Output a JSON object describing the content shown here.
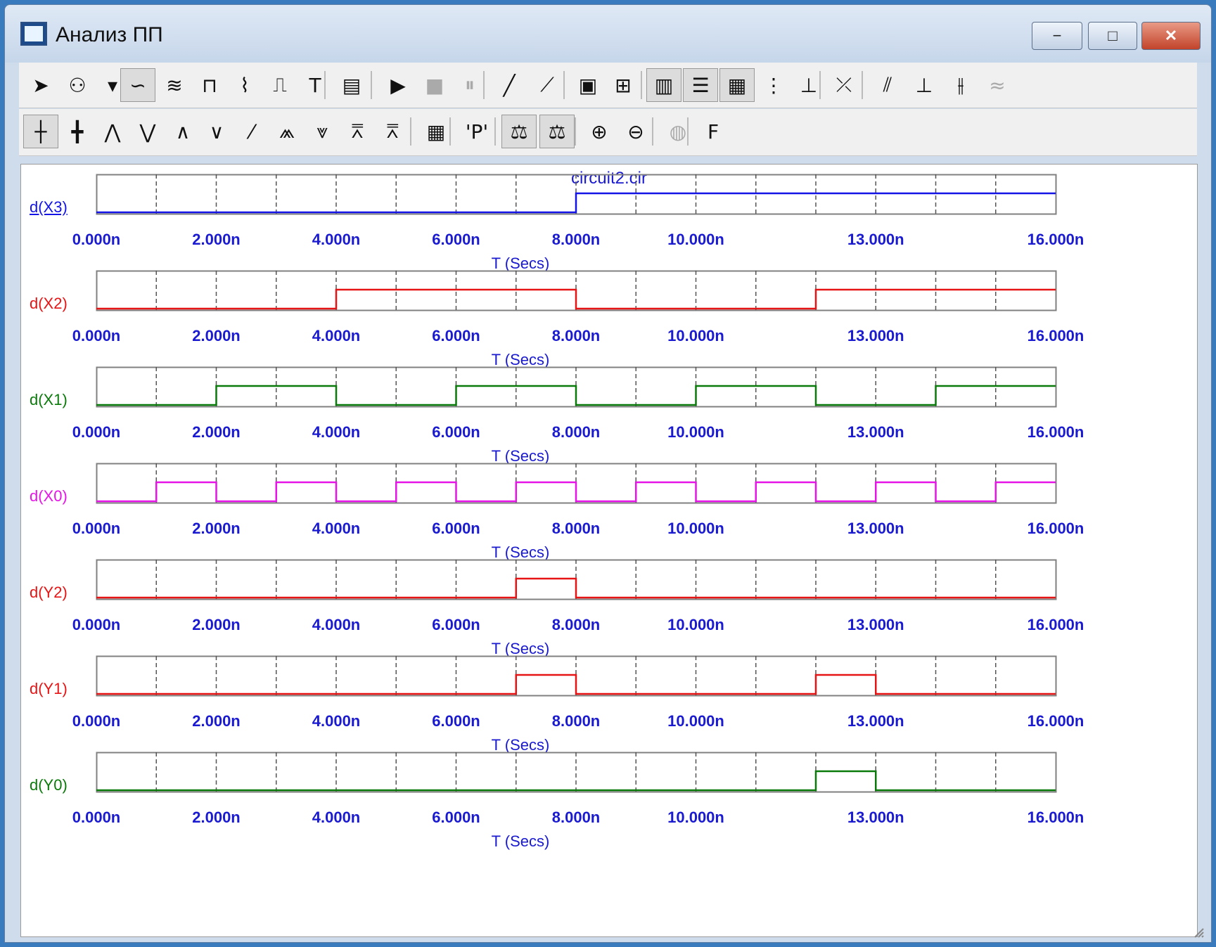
{
  "window": {
    "title": "Анализ ПП",
    "minimize_label": "−",
    "maximize_label": "□",
    "close_label": "✕"
  },
  "toolbar1": [
    {
      "name": "select-arrow-icon",
      "glyph": "➤"
    },
    {
      "name": "add-trace-icon",
      "glyph": "⚇"
    },
    {
      "name": "dropdown-arrow-icon",
      "glyph": "▾"
    },
    {
      "name": "curve-icon",
      "glyph": "∽",
      "pressed": true
    },
    {
      "name": "waveform-icon",
      "glyph": "≋"
    },
    {
      "name": "bus-icon",
      "glyph": "⊓"
    },
    {
      "name": "probe-icon",
      "glyph": "⌇"
    },
    {
      "name": "step-icon",
      "glyph": "⎍"
    },
    {
      "name": "text-icon",
      "glyph": "T"
    },
    {
      "name": "properties-icon",
      "glyph": "▤"
    },
    {
      "name": "run-icon",
      "glyph": "▶"
    },
    {
      "name": "stop-icon",
      "glyph": "■",
      "disabled": true
    },
    {
      "name": "pause-icon",
      "glyph": "⏸",
      "disabled": true
    },
    {
      "name": "line-icon",
      "glyph": "╱"
    },
    {
      "name": "polyline-icon",
      "glyph": "⟋"
    },
    {
      "name": "frame-icon",
      "glyph": "▣"
    },
    {
      "name": "grid-dots-icon",
      "glyph": "⊞"
    },
    {
      "name": "vertical-grid-icon",
      "glyph": "▥",
      "pressed": true
    },
    {
      "name": "horizontal-grid-icon",
      "glyph": "☰",
      "pressed": true
    },
    {
      "name": "minor-grid-icon",
      "glyph": "▦",
      "pressed": true
    },
    {
      "name": "dotted-grid-icon",
      "glyph": "⋮"
    },
    {
      "name": "baseline-icon",
      "glyph": "⊥"
    },
    {
      "name": "tangent-icon",
      "glyph": "⤫"
    },
    {
      "name": "cursor-left-icon",
      "glyph": "⫽"
    },
    {
      "name": "cursor-right-icon",
      "glyph": "⊥"
    },
    {
      "name": "cursor-both-icon",
      "glyph": "⫲"
    },
    {
      "name": "cursor-tag-icon",
      "glyph": "≈",
      "disabled": true
    }
  ],
  "toolbar2": [
    {
      "name": "cursor-crosshair-icon",
      "glyph": "┼",
      "pressed": true
    },
    {
      "name": "cursor-point-icon",
      "glyph": "╋"
    },
    {
      "name": "peak-icon",
      "glyph": "⋀"
    },
    {
      "name": "valley-icon",
      "glyph": "⋁"
    },
    {
      "name": "high-icon",
      "glyph": "∧"
    },
    {
      "name": "low-icon",
      "glyph": "∨"
    },
    {
      "name": "slope-icon",
      "glyph": "⁄"
    },
    {
      "name": "local-max-icon",
      "glyph": "⩕"
    },
    {
      "name": "local-min-icon",
      "glyph": "⩔"
    },
    {
      "name": "global-high-icon",
      "glyph": "⩞"
    },
    {
      "name": "global-low-icon",
      "glyph": "⩞"
    },
    {
      "name": "table-icon",
      "glyph": "▦"
    },
    {
      "name": "point-mark-icon",
      "glyph": "'P'"
    },
    {
      "name": "x-scale-icon",
      "glyph": "⚖",
      "pressed": true
    },
    {
      "name": "y-scale-icon",
      "glyph": "⚖",
      "pressed": true
    },
    {
      "name": "zoom-in-icon",
      "glyph": "⊕"
    },
    {
      "name": "zoom-out-icon",
      "glyph": "⊖"
    },
    {
      "name": "globe-icon",
      "glyph": "◍",
      "disabled": true
    },
    {
      "name": "font-icon",
      "glyph": "F"
    }
  ],
  "colors": {
    "axis_text": "#1a1ad0",
    "grid": "#555555",
    "frame": "#808080"
  },
  "plot": {
    "file_title": "circuit2.cir",
    "x_axis_label": "T (Secs)",
    "x_range": [
      0,
      16
    ],
    "grid_step": 1,
    "panels": [
      {
        "label": "d(X3)",
        "color": "#1414e6",
        "link": true,
        "high_intervals": [
          [
            8,
            16
          ]
        ],
        "ticks": [
          "0.000n",
          "2.000n",
          "4.000n",
          "6.000n",
          "8.000n",
          "10.000n",
          "13.000n",
          "16.000n"
        ]
      },
      {
        "label": "d(X2)",
        "color": "#e61414",
        "high_intervals": [
          [
            4,
            8
          ],
          [
            12,
            16
          ]
        ],
        "ticks": [
          "0.000n",
          "2.000n",
          "4.000n",
          "6.000n",
          "8.000n",
          "10.000n",
          "13.000n",
          "16.000n"
        ]
      },
      {
        "label": "d(X1)",
        "color": "#0a7a0a",
        "high_intervals": [
          [
            2,
            4
          ],
          [
            6,
            8
          ],
          [
            10,
            12
          ],
          [
            14,
            16
          ]
        ],
        "ticks": [
          "0.000n",
          "2.000n",
          "4.000n",
          "6.000n",
          "8.000n",
          "10.000n",
          "13.000n",
          "16.000n"
        ]
      },
      {
        "label": "d(X0)",
        "color": "#e614e6",
        "high_intervals": [
          [
            1,
            2
          ],
          [
            3,
            4
          ],
          [
            5,
            6
          ],
          [
            7,
            8
          ],
          [
            9,
            10
          ],
          [
            11,
            12
          ],
          [
            13,
            14
          ],
          [
            15,
            16
          ]
        ],
        "ticks": [
          "0.000n",
          "2.000n",
          "4.000n",
          "6.000n",
          "8.000n",
          "10.000n",
          "13.000n",
          "16.000n"
        ]
      },
      {
        "label": "d(Y2)",
        "color": "#e61414",
        "high_intervals": [
          [
            7,
            8
          ]
        ],
        "ticks": [
          "0.000n",
          "2.000n",
          "4.000n",
          "6.000n",
          "8.000n",
          "10.000n",
          "13.000n",
          "16.000n"
        ]
      },
      {
        "label": "d(Y1)",
        "color": "#e61414",
        "high_intervals": [
          [
            7,
            8
          ],
          [
            12,
            13
          ]
        ],
        "ticks": [
          "0.000n",
          "2.000n",
          "4.000n",
          "6.000n",
          "8.000n",
          "10.000n",
          "13.000n",
          "16.000n"
        ]
      },
      {
        "label": "d(Y0)",
        "color": "#0a7a0a",
        "high_intervals": [
          [
            12,
            13
          ]
        ],
        "ticks": [
          "0.000n",
          "2.000n",
          "4.000n",
          "6.000n",
          "8.000n",
          "10.000n",
          "13.000n",
          "16.000n"
        ]
      }
    ]
  },
  "chart_data": [
    {
      "type": "line",
      "series": [
        {
          "name": "d(X3)",
          "x": [
            0,
            8,
            8,
            16
          ],
          "values": [
            0,
            0,
            1,
            1
          ]
        }
      ],
      "xlabel": "T (Secs)",
      "xlim": [
        0,
        16
      ]
    },
    {
      "type": "line",
      "series": [
        {
          "name": "d(X2)",
          "x": [
            0,
            4,
            4,
            8,
            8,
            12,
            12,
            16
          ],
          "values": [
            0,
            0,
            1,
            1,
            0,
            0,
            1,
            1
          ]
        }
      ],
      "xlabel": "T (Secs)",
      "xlim": [
        0,
        16
      ]
    },
    {
      "type": "line",
      "series": [
        {
          "name": "d(X1)",
          "x": [
            0,
            2,
            2,
            4,
            4,
            6,
            6,
            8,
            8,
            10,
            10,
            12,
            12,
            14,
            14,
            16
          ],
          "values": [
            0,
            0,
            1,
            1,
            0,
            0,
            1,
            1,
            0,
            0,
            1,
            1,
            0,
            0,
            1,
            1
          ]
        }
      ],
      "xlabel": "T (Secs)",
      "xlim": [
        0,
        16
      ]
    },
    {
      "type": "line",
      "series": [
        {
          "name": "d(X0)",
          "x": [
            0,
            1,
            1,
            2,
            2,
            3,
            3,
            4,
            4,
            5,
            5,
            6,
            6,
            7,
            7,
            8,
            8,
            9,
            9,
            10,
            10,
            11,
            11,
            12,
            12,
            13,
            13,
            14,
            14,
            15,
            15,
            16
          ],
          "values": [
            0,
            0,
            1,
            1,
            0,
            0,
            1,
            1,
            0,
            0,
            1,
            1,
            0,
            0,
            1,
            1,
            0,
            0,
            1,
            1,
            0,
            0,
            1,
            1,
            0,
            0,
            1,
            1,
            0,
            0,
            1,
            1
          ]
        }
      ],
      "xlabel": "T (Secs)",
      "xlim": [
        0,
        16
      ]
    },
    {
      "type": "line",
      "series": [
        {
          "name": "d(Y2)",
          "x": [
            0,
            7,
            7,
            8,
            8,
            16
          ],
          "values": [
            0,
            0,
            1,
            1,
            0,
            0
          ]
        }
      ],
      "xlabel": "T (Secs)",
      "xlim": [
        0,
        16
      ]
    },
    {
      "type": "line",
      "series": [
        {
          "name": "d(Y1)",
          "x": [
            0,
            7,
            7,
            8,
            8,
            12,
            12,
            13,
            13,
            16
          ],
          "values": [
            0,
            0,
            1,
            1,
            0,
            0,
            1,
            1,
            0,
            0
          ]
        }
      ],
      "xlabel": "T (Secs)",
      "xlim": [
        0,
        16
      ]
    },
    {
      "type": "line",
      "series": [
        {
          "name": "d(Y0)",
          "x": [
            0,
            12,
            12,
            13,
            13,
            16
          ],
          "values": [
            0,
            0,
            1,
            1,
            0,
            0
          ]
        }
      ],
      "xlabel": "T (Secs)",
      "xlim": [
        0,
        16
      ]
    }
  ]
}
